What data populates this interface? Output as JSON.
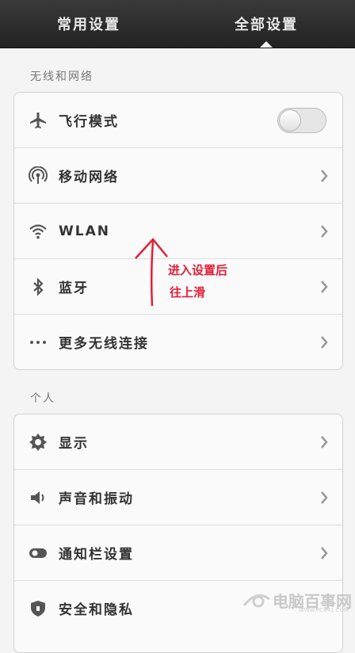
{
  "tabs": [
    {
      "label": "常用设置"
    },
    {
      "label": "全部设置"
    }
  ],
  "sections": [
    {
      "title": "无线和网络",
      "items": [
        {
          "label": "飞行模式",
          "icon": "airplane-icon",
          "toggle_on": false
        },
        {
          "label": "移动网络",
          "icon": "cellular-icon"
        },
        {
          "label": "WLAN",
          "icon": "wifi-icon"
        },
        {
          "label": "蓝牙",
          "icon": "bluetooth-icon"
        },
        {
          "label": "更多无线连接",
          "icon": "more-icon"
        }
      ]
    },
    {
      "title": "个人",
      "items": [
        {
          "label": "显示",
          "icon": "brightness-icon"
        },
        {
          "label": "声音和振动",
          "icon": "speaker-icon"
        },
        {
          "label": "通知栏设置",
          "icon": "notification-toggle-icon"
        },
        {
          "label": "安全和隐私",
          "icon": "shield-icon"
        }
      ]
    }
  ],
  "annotation": {
    "line1": "进入设置后",
    "line2": "往上滑",
    "color": "#e0203a"
  },
  "watermark": {
    "text": "电脑百事网",
    "url": "WWW.PC841.COM"
  }
}
